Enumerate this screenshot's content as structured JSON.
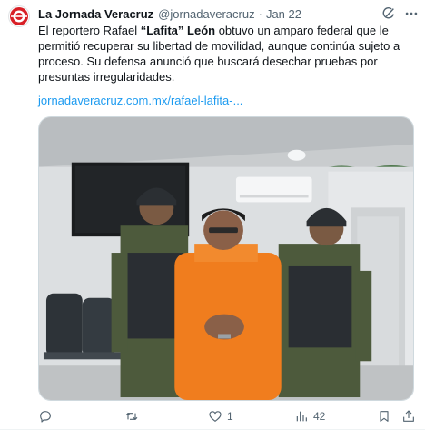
{
  "tweet": {
    "author_name": "La Jornada Veracruz",
    "author_handle": "@jornadaveracruz",
    "separator": "·",
    "timestamp": "Jan 22",
    "text_part1": "El reportero Rafael ",
    "text_bold": "“Lafita” León",
    "text_part2": " obtuvo un amparo federal que le permitió recuperar su libertad de movilidad, aunque continúa sujeto a proceso. Su defensa anunció que buscará desechar pruebas por presuntas irregularidades.",
    "link_text": "jornadaveracruz.com.mx/rafael-lafita-..."
  },
  "actions": {
    "reply_count": "",
    "repost_count": "",
    "like_count": "1",
    "views_count": "42"
  },
  "colors": {
    "accent": "#1d9bf0",
    "muted": "#536471",
    "text": "#0f1419",
    "brand_red": "#d81f26"
  },
  "icons": {
    "avatar": "jornada-veracruz-logo",
    "grok": "grok-icon",
    "more": "more-dots-icon",
    "reply": "reply-icon",
    "repost": "repost-icon",
    "like": "heart-icon",
    "views": "views-bar-chart-icon",
    "bookmark": "bookmark-icon",
    "share": "share-icon"
  }
}
